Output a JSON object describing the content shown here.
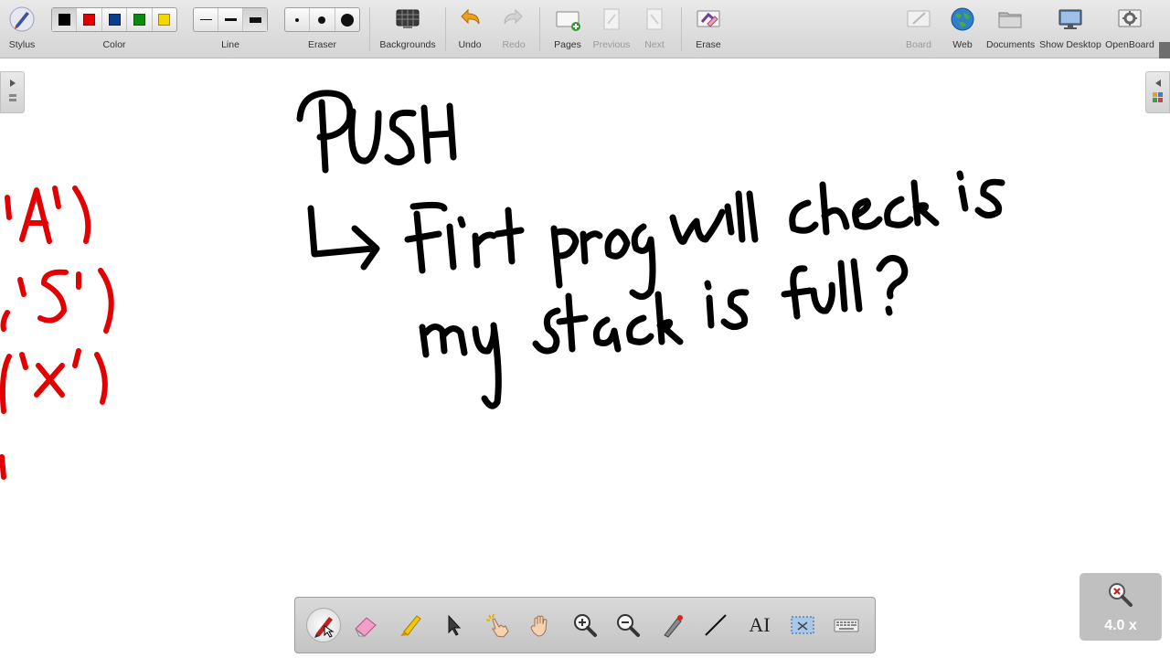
{
  "toolbar": {
    "stylus": "Stylus",
    "color": "Color",
    "line": "Line",
    "eraser": "Eraser",
    "backgrounds": "Backgrounds",
    "undo": "Undo",
    "redo": "Redo",
    "pages": "Pages",
    "previous": "Previous",
    "next": "Next",
    "erase": "Erase",
    "board": "Board",
    "web": "Web",
    "documents": "Documents",
    "show_desktop": "Show Desktop",
    "openboard": "OpenBoard",
    "colors": [
      "#000000",
      "#e00000",
      "#0a3d8f",
      "#0a8a10",
      "#f2d800"
    ]
  },
  "handwriting": {
    "ink_black": "#000000",
    "ink_red": "#e30000"
  },
  "zoom": {
    "value": "4.0 x"
  }
}
